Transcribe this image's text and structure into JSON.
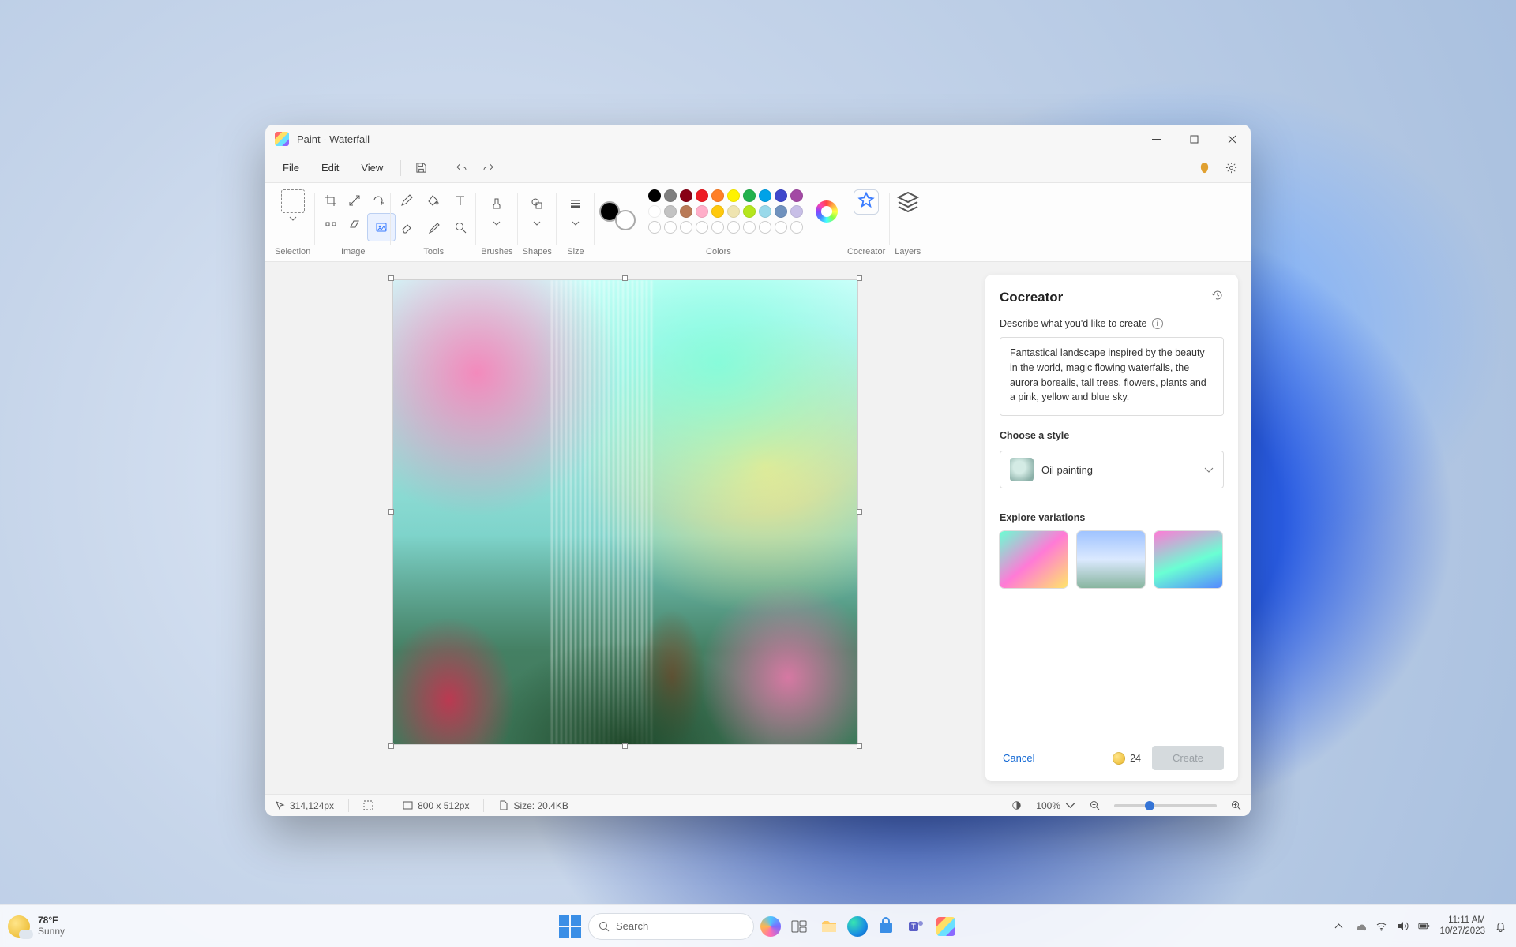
{
  "titlebar": {
    "title": "Paint - Waterfall"
  },
  "menu": {
    "file": "File",
    "edit": "Edit",
    "view": "View"
  },
  "ribbon": {
    "selection": "Selection",
    "image": "Image",
    "tools": "Tools",
    "brushes": "Brushes",
    "shapes": "Shapes",
    "size": "Size",
    "colors": "Colors",
    "cocreator": "Cocreator",
    "layers": "Layers"
  },
  "colors": {
    "current": "#000000",
    "row1": [
      "#000000",
      "#7f7f7f",
      "#880015",
      "#ed1c24",
      "#ff7f27",
      "#fff200",
      "#22b14c",
      "#00a2e8",
      "#3f48cc",
      "#a349a4"
    ],
    "row2": [
      "#ffffff",
      "#c3c3c3",
      "#b97a57",
      "#ffaec9",
      "#ffc90e",
      "#efe4b0",
      "#b5e61d",
      "#99d9ea",
      "#7092be",
      "#c8bfe7"
    ]
  },
  "cocreator_panel": {
    "title": "Cocreator",
    "describe_label": "Describe what you'd like to create",
    "prompt": "Fantastical landscape inspired by the beauty in the world, magic flowing waterfalls, the aurora borealis, tall trees, flowers, plants and a pink, yellow and blue sky.",
    "choose_style_label": "Choose a style",
    "style_value": "Oil painting",
    "explore_label": "Explore variations",
    "cancel": "Cancel",
    "credits": "24",
    "create": "Create"
  },
  "statusbar": {
    "cursor": "314,124px",
    "canvas_dims": "800  x  512px",
    "size_label": "Size: 20.4KB",
    "zoom": "100%"
  },
  "taskbar": {
    "weather_temp": "78°F",
    "weather_cond": "Sunny",
    "search_placeholder": "Search",
    "time": "11:11 AM",
    "date": "10/27/2023"
  }
}
